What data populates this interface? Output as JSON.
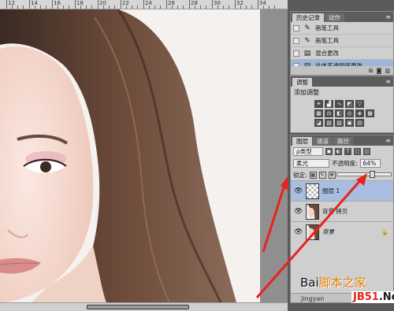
{
  "ruler_numbers": [
    "12",
    "14",
    "16",
    "18",
    "20",
    "22",
    "24",
    "26",
    "28",
    "30",
    "32",
    "34"
  ],
  "history_panel": {
    "tabs": [
      "历史记录",
      "动作"
    ],
    "items": [
      {
        "label": "画笔工具",
        "icon": "brush-icon"
      },
      {
        "label": "画笔工具",
        "icon": "brush-icon"
      },
      {
        "label": "混合更改",
        "icon": "document-icon"
      },
      {
        "label": "总体不透明度更改",
        "icon": "document-icon"
      }
    ]
  },
  "adjustments_panel": {
    "tabs": [
      "调整"
    ],
    "title": "添加调整"
  },
  "layers_panel": {
    "tabs": [
      "图层",
      "通道",
      "路径"
    ],
    "filter_type": "ρ类型",
    "blend_mode": "柔光",
    "opacity_label": "不透明度:",
    "opacity_value": "64%",
    "lock_label": "锁定:",
    "opacity_fraction": 0.64,
    "layers": [
      {
        "name": "图层 1",
        "selected": true,
        "thumb": "checker"
      },
      {
        "name": "背景 拷贝",
        "selected": false,
        "thumb": "photo"
      },
      {
        "name": "背景",
        "selected": false,
        "thumb": "photo",
        "italic": true,
        "locked": true
      }
    ]
  },
  "watermark": {
    "line1": "Bai",
    "site_cn": "脚本之家",
    "url_left": "jingyan",
    "brand": "JB51",
    "brand_suffix": ".Net"
  },
  "colors": {
    "arrow": "#e8231c",
    "selection": "#a8bde0",
    "accent": "#e67a00"
  }
}
